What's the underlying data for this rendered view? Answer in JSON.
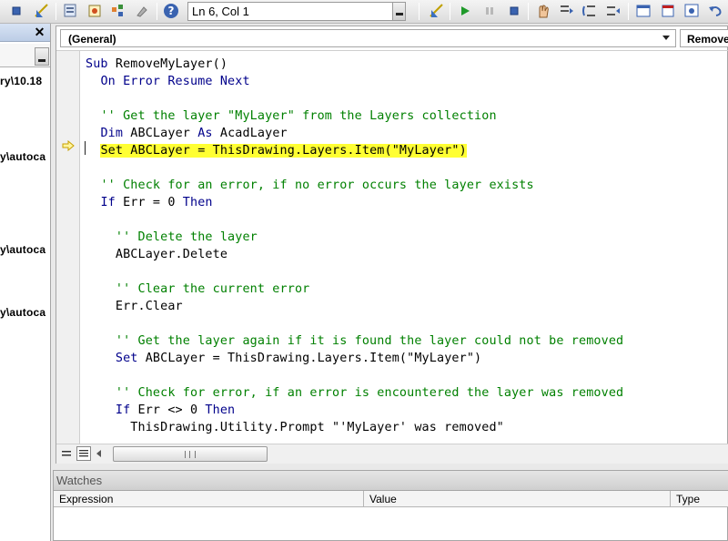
{
  "toolbar": {
    "status": "Ln 6, Col 1"
  },
  "project_panel": {
    "paths": [
      "ry\\10.18",
      "y\\autoca",
      "y\\autoca",
      "y\\autoca"
    ]
  },
  "code_window": {
    "object_combo": "(General)",
    "procedure_combo": "Remove",
    "lines": [
      {
        "indent": "",
        "parts": [
          {
            "t": "Sub ",
            "c": "kw"
          },
          {
            "t": "RemoveMyLayer()",
            "c": ""
          }
        ]
      },
      {
        "indent": "  ",
        "parts": [
          {
            "t": "On Error Resume Next",
            "c": "kw"
          }
        ]
      },
      {
        "indent": "",
        "parts": []
      },
      {
        "indent": "  ",
        "parts": [
          {
            "t": "'' Get the layer \"MyLayer\" from the Layers collection",
            "c": "cm"
          }
        ]
      },
      {
        "indent": "  ",
        "parts": [
          {
            "t": "Dim ",
            "c": "kw"
          },
          {
            "t": "ABCLayer ",
            "c": ""
          },
          {
            "t": "As ",
            "c": "kw"
          },
          {
            "t": "AcadLayer",
            "c": ""
          }
        ]
      },
      {
        "indent": "  ",
        "parts": [
          {
            "t": "Set ABCLayer = ThisDrawing.Layers.Item(\"MyLayer\")",
            "c": "hl"
          }
        ]
      },
      {
        "indent": "",
        "parts": []
      },
      {
        "indent": "  ",
        "parts": [
          {
            "t": "'' Check for an error, if no error occurs the layer exists",
            "c": "cm"
          }
        ]
      },
      {
        "indent": "  ",
        "parts": [
          {
            "t": "If ",
            "c": "kw"
          },
          {
            "t": "Err = 0 ",
            "c": ""
          },
          {
            "t": "Then",
            "c": "kw"
          }
        ]
      },
      {
        "indent": "",
        "parts": []
      },
      {
        "indent": "    ",
        "parts": [
          {
            "t": "'' Delete the layer",
            "c": "cm"
          }
        ]
      },
      {
        "indent": "    ",
        "parts": [
          {
            "t": "ABCLayer.Delete",
            "c": ""
          }
        ]
      },
      {
        "indent": "",
        "parts": []
      },
      {
        "indent": "    ",
        "parts": [
          {
            "t": "'' Clear the current error",
            "c": "cm"
          }
        ]
      },
      {
        "indent": "    ",
        "parts": [
          {
            "t": "Err.Clear",
            "c": ""
          }
        ]
      },
      {
        "indent": "",
        "parts": []
      },
      {
        "indent": "    ",
        "parts": [
          {
            "t": "'' Get the layer again if it is found the layer could not be removed",
            "c": "cm"
          }
        ]
      },
      {
        "indent": "    ",
        "parts": [
          {
            "t": "Set ",
            "c": "kw"
          },
          {
            "t": "ABCLayer = ThisDrawing.Layers.Item(\"MyLayer\")",
            "c": ""
          }
        ]
      },
      {
        "indent": "",
        "parts": []
      },
      {
        "indent": "    ",
        "parts": [
          {
            "t": "'' Check for error, if an error is encountered the layer was removed",
            "c": "cm"
          }
        ]
      },
      {
        "indent": "    ",
        "parts": [
          {
            "t": "If ",
            "c": "kw"
          },
          {
            "t": "Err <> 0 ",
            "c": ""
          },
          {
            "t": "Then",
            "c": "kw"
          }
        ]
      },
      {
        "indent": "      ",
        "parts": [
          {
            "t": "ThisDrawing.Utility.Prompt \"'MyLayer' was removed\"",
            "c": ""
          }
        ]
      }
    ],
    "breakpoint_line": 6
  },
  "watches": {
    "title": "Watches",
    "columns": [
      "Expression",
      "Value",
      "Type"
    ]
  },
  "colors": {
    "keyword": "#00008b",
    "comment": "#008000",
    "highlight": "#ffff33",
    "marker": "#e0c000"
  },
  "icons": [
    "stop-icon",
    "design-mode-icon",
    "project-explorer-icon",
    "properties-icon",
    "object-browser-icon",
    "toolbox-icon",
    "help-icon",
    "run-icon",
    "break-icon",
    "reset-icon",
    "toggle-breakpoint-icon",
    "step-into-icon",
    "step-over-icon",
    "step-out-icon",
    "locals-icon",
    "immediate-icon",
    "watch-icon",
    "undo-icon"
  ]
}
